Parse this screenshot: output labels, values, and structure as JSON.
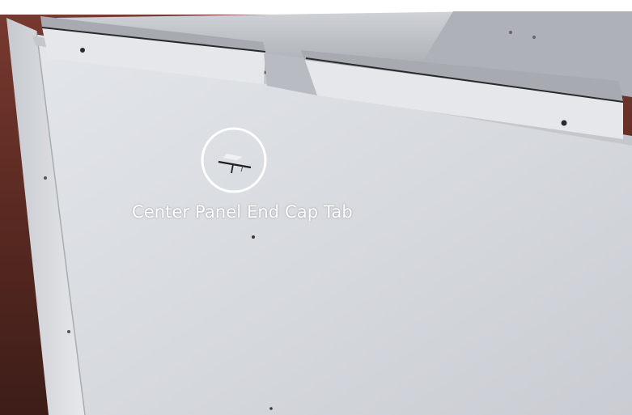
{
  "photo": {
    "subject": "Center Panel End Cap Tab",
    "callout": {
      "label": "Center Panel End Cap Tab",
      "marker_shape": "circle"
    }
  },
  "colors": {
    "panel": "#dcdfe4",
    "panel_shadow": "#b9bdc4",
    "background": "#5a2a22",
    "rail": "#bfc2c7",
    "callout": "#ffffff"
  }
}
